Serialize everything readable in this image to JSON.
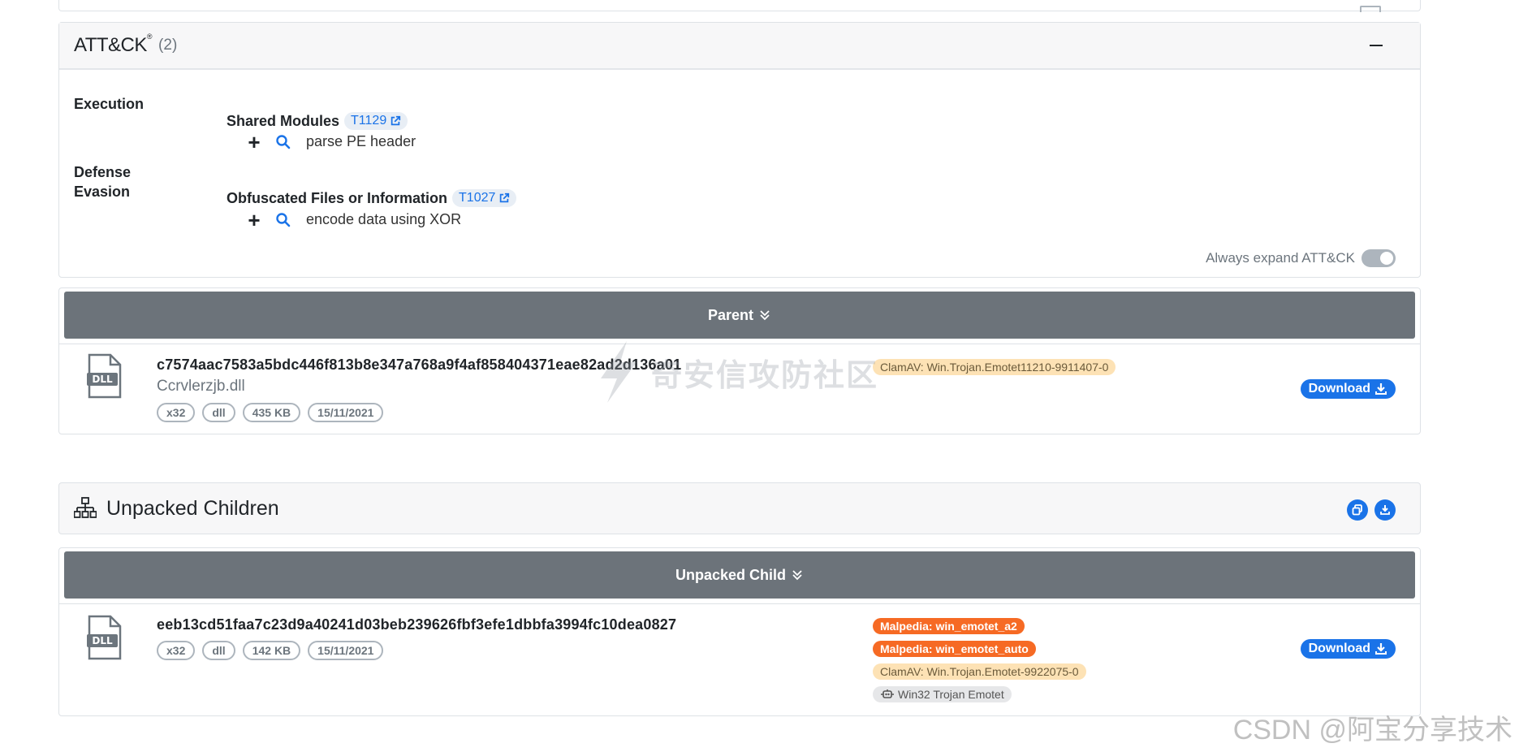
{
  "attack": {
    "title": "ATT&CK",
    "registered": "®",
    "count": "(2)",
    "tactics": [
      {
        "name": "Execution",
        "technique": "Shared Modules",
        "technique_id": "T1129",
        "capability": "parse PE header"
      },
      {
        "name": "Defense Evasion",
        "technique": "Obfuscated Files or Information",
        "technique_id": "T1027",
        "capability": "encode data using XOR"
      }
    ],
    "always_expand_label": "Always expand ATT&CK"
  },
  "parent": {
    "bar_label": "Parent",
    "file_type": "DLL",
    "hash": "c7574aac7583a5bdc446f813b8e347a768a9f4af858404371eae82ad2d136a01",
    "filename": "Ccrvlerzjb.dll",
    "badges": [
      "x32",
      "dll",
      "435 KB",
      "15/11/2021"
    ],
    "tags": [
      "ClamAV: Win.Trojan.Emotet11210-9911407-0"
    ],
    "download_label": "Download"
  },
  "children_section": {
    "title": "Unpacked Children"
  },
  "child": {
    "bar_label": "Unpacked Child",
    "file_type": "DLL",
    "hash": "eeb13cd51faa7c23d9a40241d03beb239626fbf3efe1dbbfa3994fc10dea0827",
    "badges": [
      "x32",
      "dll",
      "142 KB",
      "15/11/2021"
    ],
    "tags": [
      "Malpedia: win_emotet_a2",
      "Malpedia: win_emotet_auto",
      "ClamAV: Win.Trojan.Emotet-9922075-0",
      "Win32 Trojan Emotet"
    ],
    "download_label": "Download"
  },
  "watermarks": {
    "center": "奇安信攻防社区",
    "corner": "CSDN @阿宝分享技术"
  },
  "colors": {
    "accent": "#1a73e8",
    "bar": "#6c737a",
    "malpedia": "#f66a24",
    "clamav": "#fde2b5"
  }
}
